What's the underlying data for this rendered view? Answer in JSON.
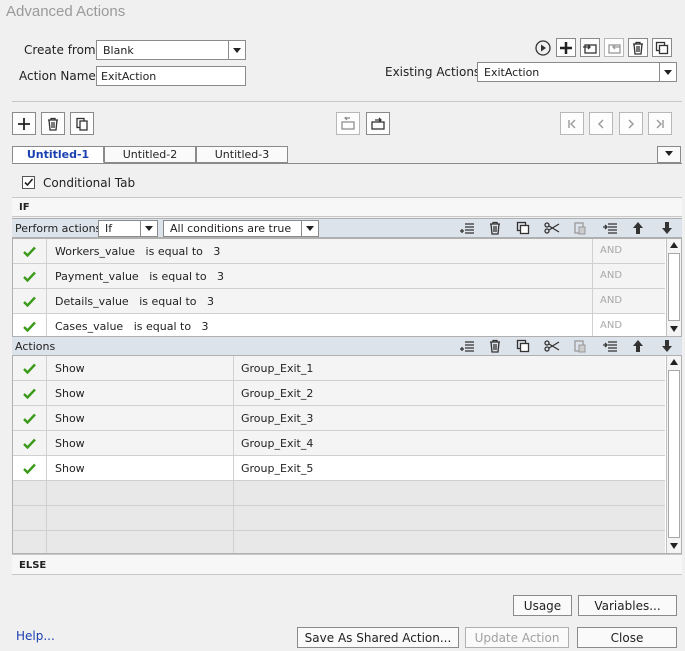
{
  "window": {
    "title": "Advanced Actions"
  },
  "form": {
    "create_from_label": "Create from:",
    "create_from_value": "Blank",
    "action_name_label": "Action Name:",
    "action_name_value": "ExitAction",
    "existing_actions_label": "Existing Actions:",
    "existing_actions_value": "ExitAction"
  },
  "tabs": [
    {
      "label": "Untitled-1",
      "active": true
    },
    {
      "label": "Untitled-2",
      "active": false
    },
    {
      "label": "Untitled-3",
      "active": false
    }
  ],
  "conditional_tab": {
    "label": "Conditional Tab",
    "checked": true
  },
  "if_section": {
    "header": "IF",
    "perform_actions_label": "Perform actions:",
    "perform_actions_value": "If",
    "conditions_value": "All conditions are true",
    "conditions": [
      {
        "variable": "Workers_value",
        "operator": "is equal to",
        "value": "3",
        "conjunction": "AND"
      },
      {
        "variable": "Payment_value",
        "operator": "is equal to",
        "value": "3",
        "conjunction": "AND"
      },
      {
        "variable": "Details_value",
        "operator": "is equal to",
        "value": "3",
        "conjunction": "AND"
      },
      {
        "variable": "Cases_value",
        "operator": "is equal to",
        "value": "3",
        "conjunction": "AND"
      }
    ]
  },
  "actions_section": {
    "header": "Actions",
    "rows": [
      {
        "action": "Show",
        "target": "Group_Exit_1"
      },
      {
        "action": "Show",
        "target": "Group_Exit_2"
      },
      {
        "action": "Show",
        "target": "Group_Exit_3"
      },
      {
        "action": "Show",
        "target": "Group_Exit_4"
      },
      {
        "action": "Show",
        "target": "Group_Exit_5"
      }
    ]
  },
  "else_section": {
    "header": "ELSE"
  },
  "footer": {
    "usage": "Usage",
    "variables": "Variables...",
    "help": "Help...",
    "save_shared": "Save As Shared Action...",
    "update": "Update Action",
    "close": "Close"
  },
  "colors": {
    "check": "#3a9a1a",
    "active_tab": "#1a3fb0",
    "link": "#1a3fb0",
    "bar": "#dde3ea"
  }
}
